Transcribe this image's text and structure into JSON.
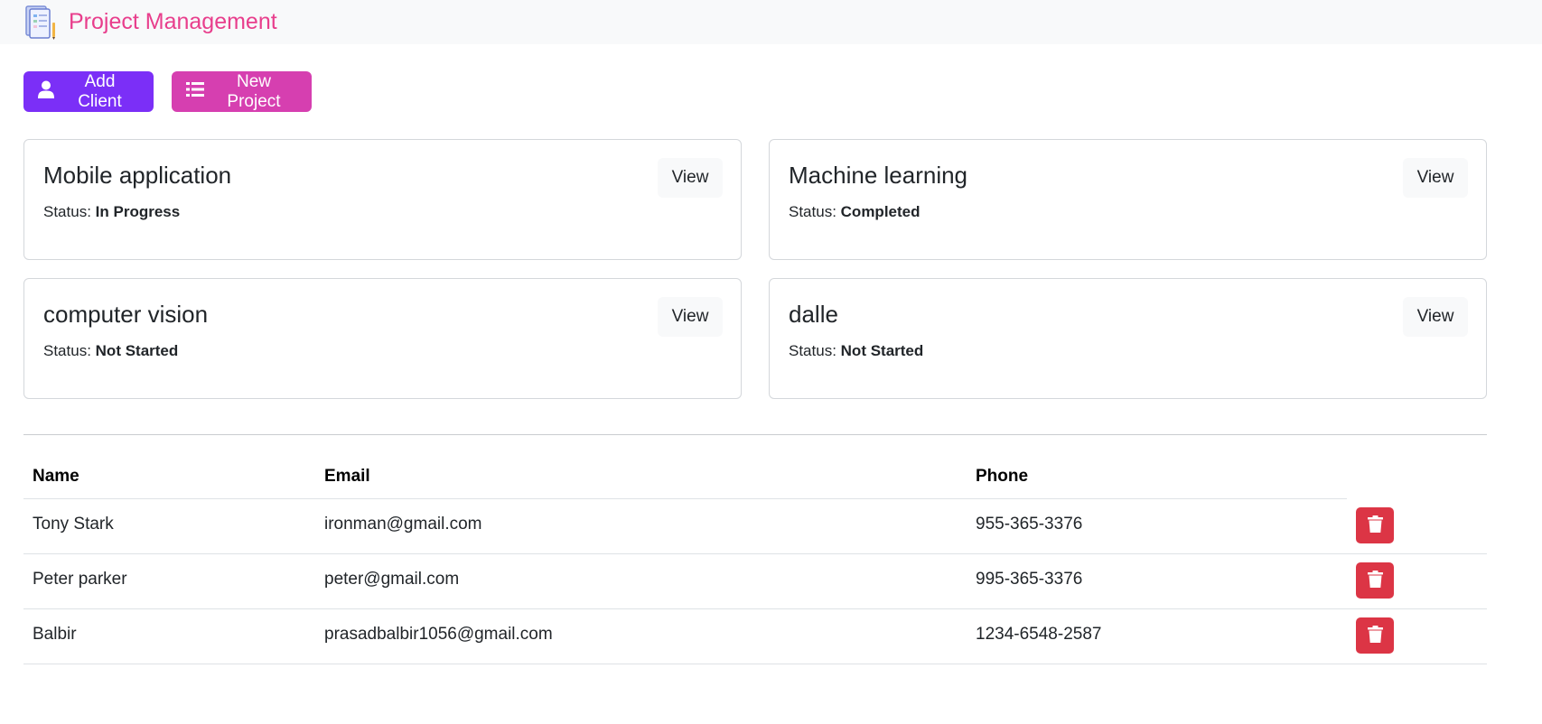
{
  "navbar": {
    "title": "Project Management",
    "logo_icon": "clipboard-logo-icon",
    "title_color": "#e83e8c"
  },
  "actions": {
    "add_client": {
      "label": "Add Client",
      "icon": "user-icon",
      "color": "#7b2ff7"
    },
    "new_project": {
      "label": "New Project",
      "icon": "list-icon",
      "color": "#d63fb0"
    }
  },
  "projects": [
    {
      "name": "Mobile application",
      "status_label": "Status:",
      "status": "In Progress",
      "view_label": "View"
    },
    {
      "name": "Machine learning",
      "status_label": "Status:",
      "status": "Completed",
      "view_label": "View"
    },
    {
      "name": "computer vision",
      "status_label": "Status:",
      "status": "Not Started",
      "view_label": "View"
    },
    {
      "name": "dalle",
      "status_label": "Status:",
      "status": "Not Started",
      "view_label": "View"
    }
  ],
  "clients": {
    "headers": {
      "name": "Name",
      "email": "Email",
      "phone": "Phone"
    },
    "rows": [
      {
        "name": "Tony Stark",
        "email": "ironman@gmail.com",
        "phone": "955-365-3376"
      },
      {
        "name": "Peter parker",
        "email": "peter@gmail.com",
        "phone": "995-365-3376"
      },
      {
        "name": "Balbir",
        "email": "prasadbalbir1056@gmail.com",
        "phone": "1234-6548-2587"
      }
    ],
    "delete_icon": "trash-icon",
    "delete_color": "#dc3545"
  }
}
